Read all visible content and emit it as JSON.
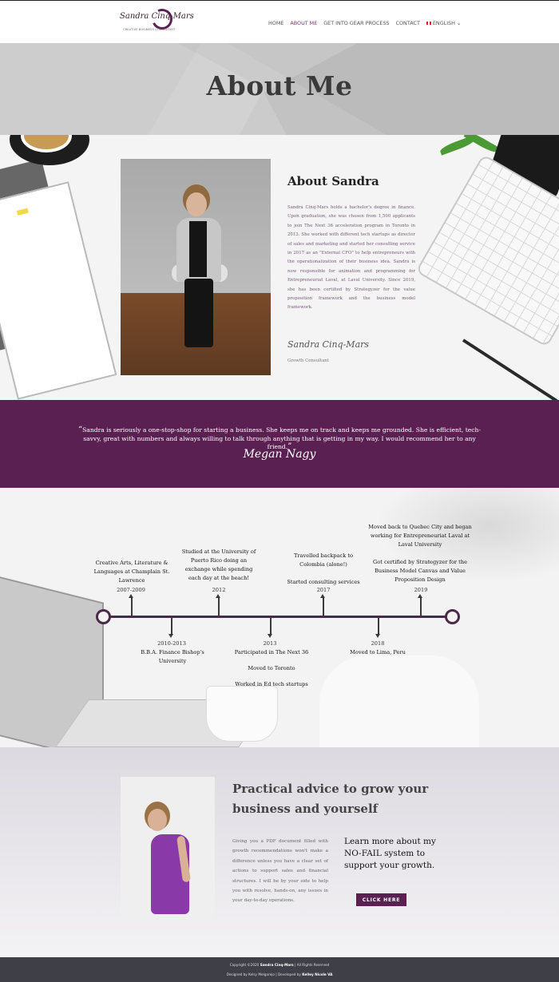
{
  "header": {
    "logo_name": "Sandra Cinq-Mars",
    "logo_tagline": "CREATIVE BUSINESS CONSULTANT",
    "nav": [
      "HOME",
      "ABOUT ME",
      "GET INTO GEAR PROCESS",
      "CONTACT",
      "ENGLISH"
    ],
    "active_nav": "ABOUT ME",
    "language_icon": "flag-canada-icon"
  },
  "hero": {
    "title": "About Me"
  },
  "about": {
    "title": "About Sandra",
    "body": "Sandra Cinq-Mars holds a bachelor's degree in finance. Upon graduation, she was chosen from 1,500 applicants to join The Next 36 acceleration program in Toronto in 2013. She worked with different tech startups as director of sales and marketing and started her consulting service in 2017 as an \"External CFO\" to help entrepreneurs with the operationalization of their business idea. Sandra is now responsible for animation and programming for Entrepreneuriat Laval, at Laval University. Since 2019, she has been certified by Strategyzer for the value proposition framework and the business model framework.",
    "signature": "Sandra Cinq-Mars",
    "role": "Growth Consultant"
  },
  "testimonial": {
    "quote": "Sandra is seriously a one-stop-shop for starting a business. She keeps me on track and keeps me grounded. She is efficient, tech-savvy, great with numbers and always willing to talk through anything that is getting in my way. I would recommend her to any friend.",
    "author": "Megan Nagy"
  },
  "timeline": {
    "above": [
      {
        "year": "2007-2009",
        "text": "Creative Arts, Literature & Languages at Champlain St. Lawrence"
      },
      {
        "year": "2012",
        "text": "Studied at the University of Puerto Rico doing an exchange while spending each day at the beach!"
      },
      {
        "year": "2017",
        "text": "Travelled backpack to Colombia (alone!)\n\nStarted consulting services"
      },
      {
        "year": "2019",
        "text": "Moved back to Quebec City and began working for Entrepreneuriat Laval at Laval University\n\nGot certified by Strategyzer for the Business Model Canvas and Value Proposition Design"
      }
    ],
    "below": [
      {
        "year": "2010-2013",
        "text": "B.B.A. Finance Bishop's University"
      },
      {
        "year": "2013",
        "text": "Participated in The Next 36\n\nMoved to Toronto\n\nWorked in Ed tech startups"
      },
      {
        "year": "2018",
        "text": "Moved to Lima, Peru"
      }
    ]
  },
  "advice": {
    "title": "Practical advice to grow your business and yourself",
    "body": "Giving you a PDF document filled with growth recommendations won't make a difference unless you have a clear set of actions to support sales and financial structures. I will be by your side to help you with resolve, hands-on, any issues in your day-to-day operations.",
    "cta_text": "Learn more about my NO-FAIL system to support your growth.",
    "button_label": "CLICK HERE"
  },
  "footer": {
    "copyright_prefix": "Copyright ©2020",
    "copyright_name": "Sandra Cinq-Mars",
    "copyright_suffix": "| All Rights Reserved",
    "designed_prefix": "Designed by Kelsy Melgarejo | Developed by",
    "developer": "Kelley Nicole VA"
  },
  "colors": {
    "brand": "#5a2051",
    "nav_active": "#7a3a72",
    "footer": "#3f3f48",
    "hero": "#c6c6c6"
  }
}
